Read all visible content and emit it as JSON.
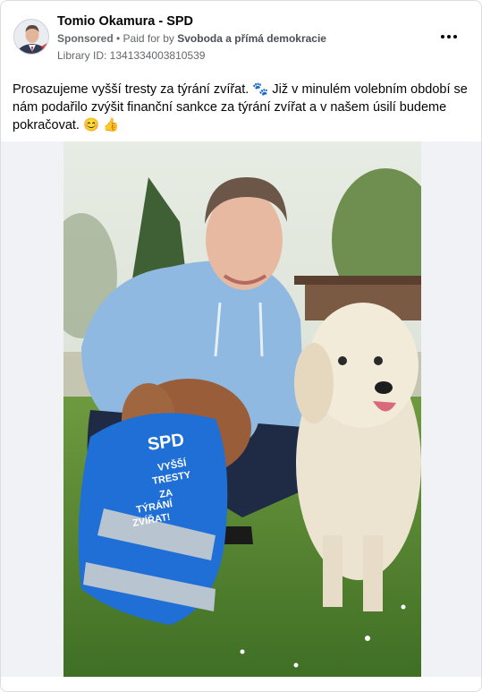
{
  "ad": {
    "page_name": "Tomio Okamura - SPD",
    "sponsored_label": "Sponsored",
    "separator": " • ",
    "paid_for_prefix": "Paid for by ",
    "payer": "Svoboda a přímá demokracie",
    "library_id": "Library ID: 1341334003810539",
    "body_text": "Prosazujeme vyšší tresty za týrání zvířat. 🐾 Již v minulém volebním období se nám podařilo zvýšit finanční sankce za týrání zvířat a v našem úsilí budeme pokračovat. 😊 👍"
  },
  "photo": {
    "vest_logo": "SPD",
    "vest_text": [
      "VYŠŠÍ",
      "TRESTY",
      "ZA",
      "TÝRÁNÍ",
      "ZVÍŘAT!"
    ]
  },
  "icons": {
    "more": "more-options-icon",
    "avatar": "profile-avatar"
  },
  "colors": {
    "text": "#050505",
    "secondary": "#65676b",
    "border": "#dadde1",
    "media_bg": "#f0f2f5",
    "vest_blue": "#1f6fd6"
  }
}
